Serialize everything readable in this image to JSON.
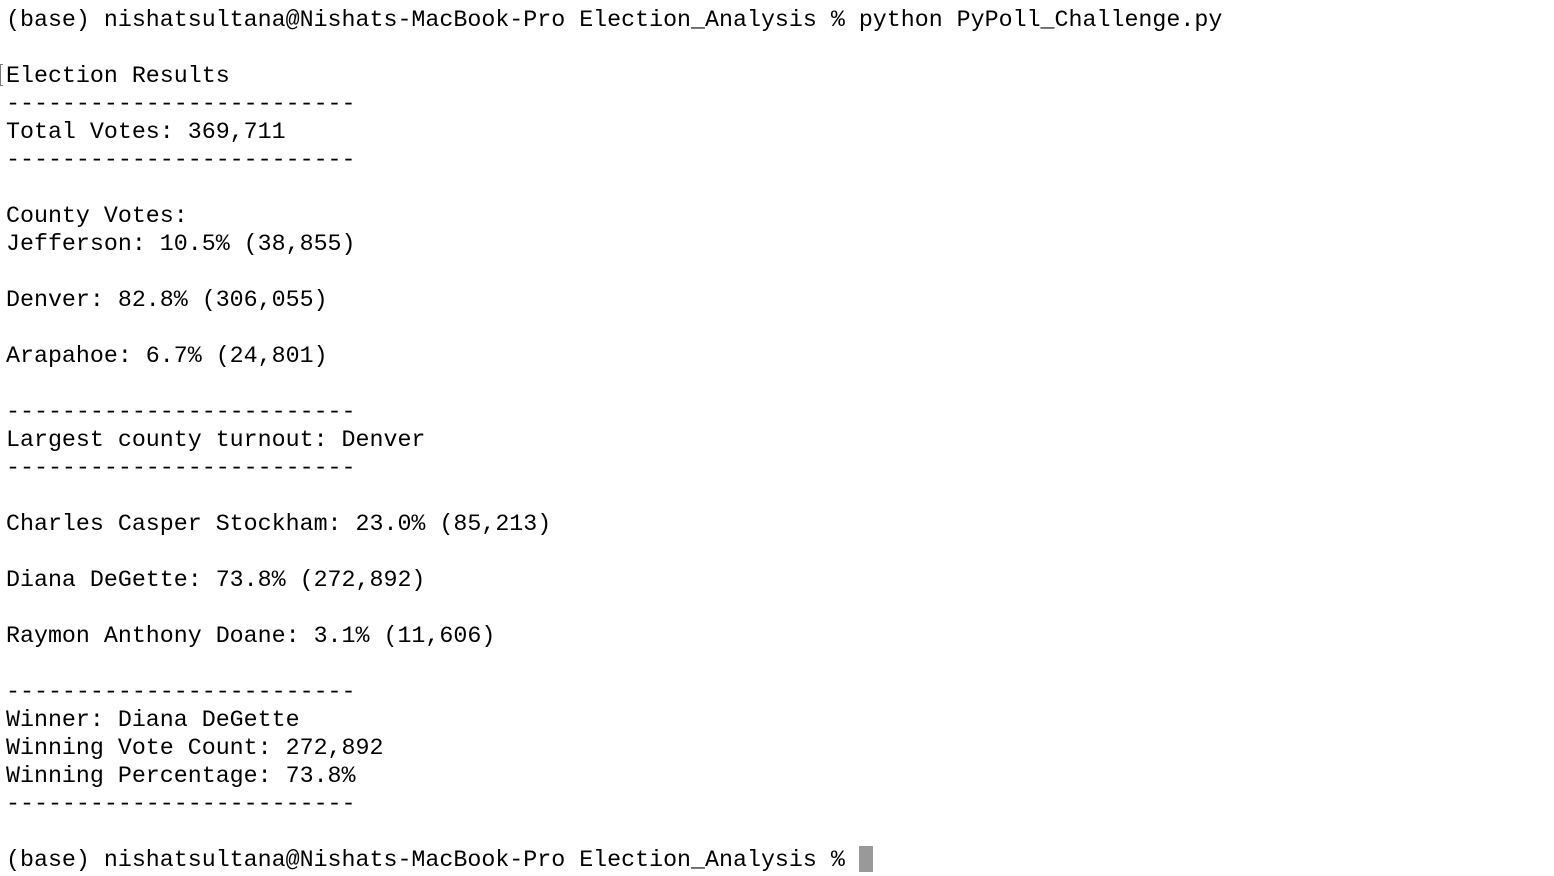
{
  "terminal": {
    "prompt": "(base) nishatsultana@Nishats-MacBook-Pro Election_Analysis % ",
    "command": "python PyPoll_Challenge.py",
    "separator": "-------------------------",
    "title": "Election Results",
    "total_votes": "Total Votes: 369,711",
    "county_votes_header": "County Votes:",
    "counties": [
      "Jefferson: 10.5% (38,855)",
      "Denver: 82.8% (306,055)",
      "Arapahoe: 6.7% (24,801)"
    ],
    "largest_county": "Largest county turnout: Denver",
    "candidates": [
      "Charles Casper Stockham: 23.0% (85,213)",
      "Diana DeGette: 73.8% (272,892)",
      "Raymon Anthony Doane: 3.1% (11,606)"
    ],
    "winner": "Winner: Diana DeGette",
    "winning_vote_count": "Winning Vote Count: 272,892",
    "winning_percentage": "Winning Percentage: 73.8%",
    "final_prompt": "(base) nishatsultana@Nishats-MacBook-Pro Election_Analysis % ",
    "cursor_color": "#999999"
  }
}
